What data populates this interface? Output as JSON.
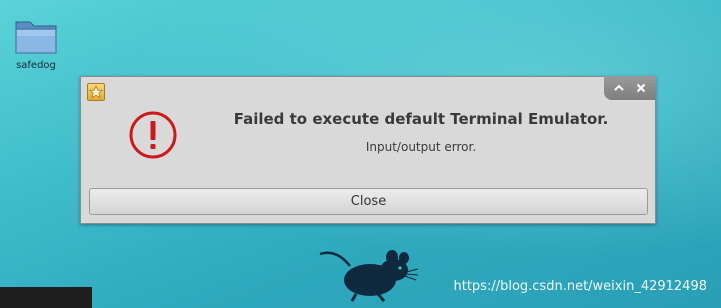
{
  "desktop": {
    "icons": [
      {
        "label": "safedog",
        "icon": "folder-icon"
      }
    ]
  },
  "dialog": {
    "app_icon": "star-app-icon",
    "controls": [
      {
        "name": "maximize",
        "icon": "chevron-up-icon"
      },
      {
        "name": "close",
        "icon": "close-icon"
      }
    ],
    "status_icon": "error-icon",
    "title": "Failed to execute default Terminal Emulator.",
    "detail": "Input/output error.",
    "close_button_label": "Close"
  },
  "watermark": "https://blog.csdn.net/weixin_42912498",
  "colors": {
    "desktop_bg": "#3fbccb",
    "dialog_bg": "#d9d9d9",
    "error_red": "#cc1a1a",
    "text": "#3a3a3a"
  }
}
